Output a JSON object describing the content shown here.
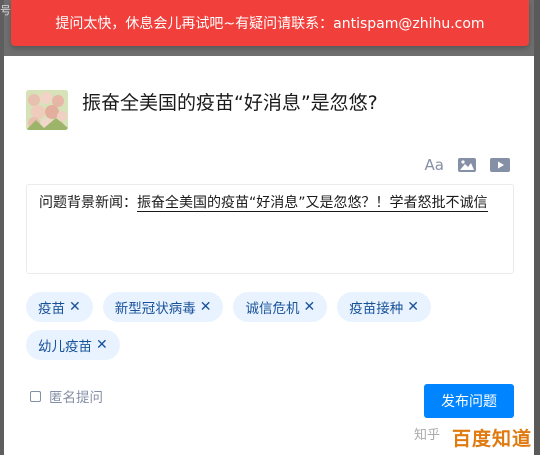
{
  "edge": {
    "glyph": "号"
  },
  "toast": {
    "text": "提问太快，休息会儿再试吧~有疑问请联系：antispam@zhihu.com"
  },
  "question": {
    "title": "振奋全美国的疫苗“好消息”是忽悠?"
  },
  "toolbar": {
    "font_icon_label": "Aa",
    "icons": [
      "font-size-icon",
      "image-icon",
      "video-icon"
    ]
  },
  "editor": {
    "prefix": "问题背景新闻：",
    "link_text": "振奋全美国的疫苗“好消息”又是忽悠？！学者怒批不诚信"
  },
  "tags": [
    "疫苗",
    "新型冠状病毒",
    "诚信危机",
    "疫苗接种",
    "幼儿疫苗"
  ],
  "tag_remove_glyph": "✕",
  "anonymous": {
    "label": "匿名提问",
    "checked": false
  },
  "publish": {
    "label": "发布问题"
  },
  "watermark": {
    "small": "知乎",
    "big": "百度知道"
  },
  "colors": {
    "toast_bg": "#f1403c",
    "primary": "#0084ff",
    "tag_bg": "#e9f3ff",
    "tag_text": "#175199"
  }
}
